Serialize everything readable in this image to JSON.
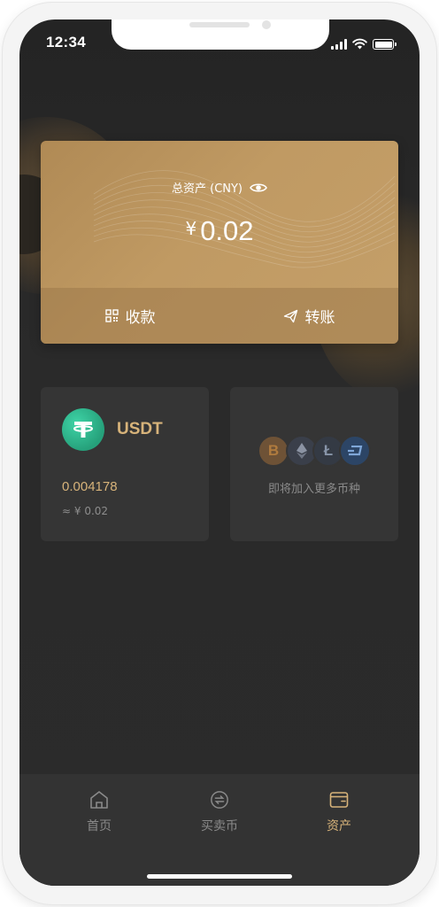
{
  "status_bar": {
    "time": "12:34",
    "icons": [
      "cellular-signal-icon",
      "wifi-icon",
      "battery-icon"
    ]
  },
  "asset_card": {
    "label": "总资产 (CNY)",
    "currency_symbol": "¥",
    "amount": "0.02",
    "visibility_icon": "eye-icon",
    "actions": [
      {
        "label": "收款",
        "icon": "qr-code-icon"
      },
      {
        "label": "转账",
        "icon": "send-icon"
      }
    ]
  },
  "coins": [
    {
      "symbol": "USDT",
      "balance": "0.004178",
      "fiat_value": "≈ ¥ 0.02",
      "icon": "tether-icon"
    }
  ],
  "more_coins": {
    "text": "即将加入更多币种",
    "icons": [
      "bitcoin-icon",
      "ethereum-icon",
      "litecoin-icon",
      "dash-icon"
    ]
  },
  "bottom_nav": {
    "items": [
      {
        "label": "首页",
        "icon": "home-icon",
        "active": false
      },
      {
        "label": "买卖币",
        "icon": "exchange-icon",
        "active": false
      },
      {
        "label": "资产",
        "icon": "wallet-icon",
        "active": true
      }
    ]
  },
  "colors": {
    "accent_gold": "#d7b37a",
    "card_gold": "#c09a63",
    "background": "#2a2a2a",
    "tether_green": "#26a17b"
  }
}
